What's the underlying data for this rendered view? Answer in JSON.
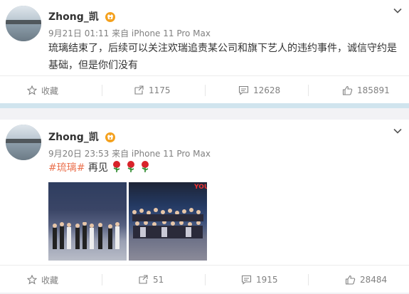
{
  "posts": [
    {
      "author": "Zhong_凯",
      "meta": "9月21日 01:11 来自 iPhone 11 Pro Max",
      "text": "琉璃结束了，后续可以关注欢瑞追责某公司和旗下艺人的违约事件，诚信守约是基础，但是你们没有",
      "actions": {
        "favorite": "收藏",
        "repost": "1175",
        "comment": "12628",
        "like": "185891"
      }
    },
    {
      "author": "Zhong_凯",
      "meta": "9月20日 23:53 来自 iPhone 11 Pro Max",
      "tag": "#琉璃#",
      "text": " 再见",
      "photo_overlay": "YOU",
      "actions": {
        "favorite": "收藏",
        "repost": "51",
        "comment": "1915",
        "like": "28484"
      }
    }
  ],
  "colors": {
    "accent": "#eb7350",
    "muted": "#808080",
    "separator": "#d0e4ee",
    "vip": "#f4a11e"
  },
  "icons": [
    "star-icon",
    "repost-icon",
    "comment-icon",
    "like-icon",
    "chevron-down-icon",
    "vip-badge-icon",
    "rose-icon"
  ]
}
